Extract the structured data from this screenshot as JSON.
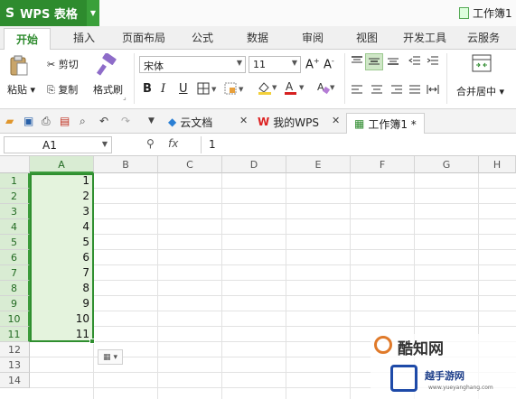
{
  "app": {
    "name": "WPS 表格",
    "document_title": "工作簿1"
  },
  "tabs": [
    "开始",
    "插入",
    "页面布局",
    "公式",
    "数据",
    "审阅",
    "视图",
    "开发工具",
    "云服务"
  ],
  "ribbon": {
    "paste": "粘贴",
    "cut": "剪切",
    "copy": "复制",
    "format_painter": "格式刷",
    "font_name": "宋体",
    "font_size": "11",
    "bold": "B",
    "italic": "I",
    "underline": "U",
    "merge_center": "合并居中"
  },
  "doc_tabs": [
    {
      "label": "云文档"
    },
    {
      "label": "我的WPS"
    },
    {
      "label": "工作簿1 *"
    }
  ],
  "formula_bar": {
    "name_box": "A1",
    "fx": "fx",
    "value": "1"
  },
  "sheet": {
    "columns": [
      "A",
      "B",
      "C",
      "D",
      "E",
      "F",
      "G",
      "H"
    ],
    "rows": [
      "1",
      "2",
      "3",
      "4",
      "5",
      "6",
      "7",
      "8",
      "9",
      "10",
      "11",
      "12",
      "13",
      "14"
    ],
    "column_a_values": [
      "1",
      "2",
      "3",
      "4",
      "5",
      "6",
      "7",
      "8",
      "9",
      "10",
      "11"
    ]
  },
  "watermark": {
    "title": "酷知网",
    "subtitle": "越手游网",
    "url": "www.yueyanghang.com"
  },
  "colors": {
    "brand_green": "#2e8b2e",
    "selection_fill": "#e4f3dd",
    "selection_border": "#2f8f2f"
  }
}
